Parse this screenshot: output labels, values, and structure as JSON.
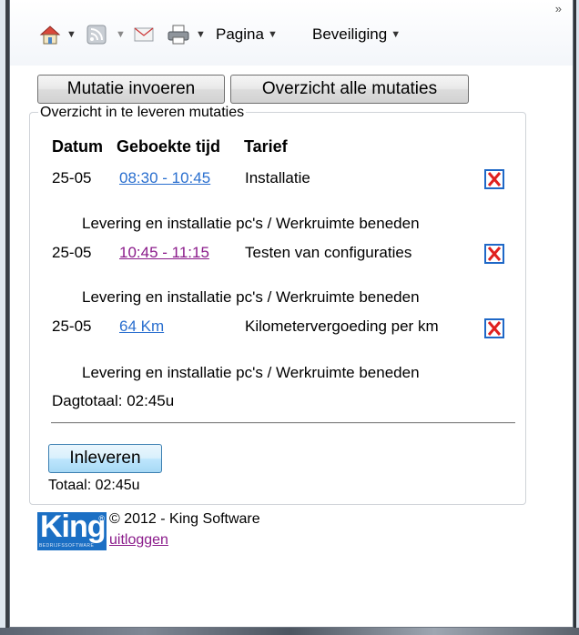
{
  "toolbar": {
    "home_icon": "home-icon",
    "feeds_icon": "feeds-icon",
    "mail_icon": "mail-icon",
    "print_icon": "print-icon",
    "page_label": "Pagina",
    "security_label": "Beveiliging",
    "overflow_glyph": "»"
  },
  "actions": {
    "new_mutation": "Mutatie invoeren",
    "all_mutations": "Overzicht alle mutaties"
  },
  "overview": {
    "legend": "Overzicht in te leveren mutaties",
    "columns": [
      "Datum",
      "Geboekte tijd",
      "Tarief"
    ],
    "rows": [
      {
        "date": "25-05",
        "time": "08:30 - 10:45",
        "rate": "Installatie",
        "description": "Levering en installatie pc's / Werkruimte beneden"
      },
      {
        "date": "25-05",
        "time": "10:45 - 11:15",
        "rate": "Testen van configuraties",
        "description": "Levering en installatie pc's / Werkruimte beneden"
      },
      {
        "date": "25-05",
        "time": "64 Km",
        "rate": "Kilometervergoeding per km",
        "description": "Levering en installatie pc's / Werkruimte beneden"
      }
    ],
    "day_total": "Dagtotaal: 02:45u",
    "submit_label": "Inleveren",
    "total": "Totaal: 02:45u"
  },
  "footer": {
    "logo_text": "King",
    "logo_subtext": "BEDRIJFSSOFTWARE",
    "copyright": "© 2012 - King Software",
    "logout": "uitloggen"
  },
  "colors": {
    "link": "#2a6fcf",
    "visited_link": "#8a1a8a",
    "delete_border": "#1f68c7",
    "delete_cross": "#e0201f",
    "logo_bg": "#1b6fc4"
  }
}
